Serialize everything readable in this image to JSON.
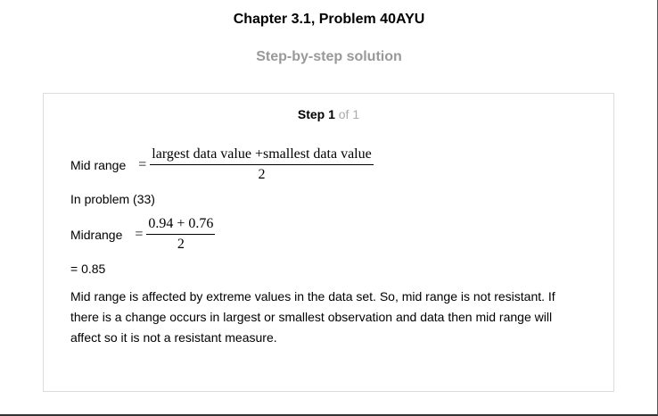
{
  "header": {
    "title": "Chapter 3.1, Problem 40AYU",
    "subtitle": "Step-by-step solution"
  },
  "step": {
    "label": "Step 1",
    "of": "of 1"
  },
  "content": {
    "formula1": {
      "label": "Mid range",
      "sign": "=",
      "numerator": "largest data value +smallest data value",
      "denominator": "2"
    },
    "line_problem": "In problem (33)",
    "formula2": {
      "label": "Midrange",
      "sign": "=",
      "numerator": "0.94 + 0.76",
      "denominator": "2"
    },
    "result": "= 0.85",
    "explanation": "Mid range is affected by extreme values in the data set. So, mid range is not resistant. If there is a change occurs in largest or smallest observation and data then mid range will affect so it is not a resistant measure."
  }
}
